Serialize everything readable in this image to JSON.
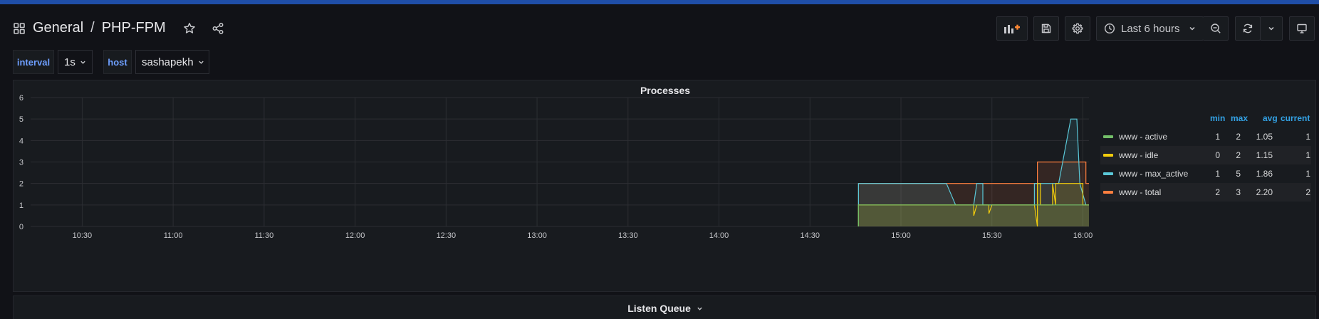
{
  "breadcrumb": {
    "folder": "General",
    "separator": "/",
    "dashboard": "PHP-FPM"
  },
  "toolbar": {
    "time_range": "Last 6 hours"
  },
  "variables": [
    {
      "label": "interval",
      "value": "1s"
    },
    {
      "label": "host",
      "value": "sashapekh"
    }
  ],
  "panel": {
    "title": "Processes",
    "legend": {
      "headers": {
        "min": "min",
        "max": "max",
        "avg": "avg",
        "current": "current"
      },
      "items": [
        {
          "name": "www - active",
          "color": "#73bf69",
          "min": "1",
          "max": "2",
          "avg": "1.05",
          "current": "1"
        },
        {
          "name": "www - idle",
          "color": "#f2cc0c",
          "min": "0",
          "max": "2",
          "avg": "1.15",
          "current": "1"
        },
        {
          "name": "www - max_active",
          "color": "#5ac8d8",
          "min": "1",
          "max": "5",
          "avg": "1.86",
          "current": "1"
        },
        {
          "name": "www - total",
          "color": "#ff7f3f",
          "min": "2",
          "max": "3",
          "avg": "2.20",
          "current": "2"
        }
      ]
    }
  },
  "chart_data": {
    "type": "area",
    "title": "Processes",
    "x_ticks": [
      "10:30",
      "11:00",
      "11:30",
      "12:00",
      "12:30",
      "13:00",
      "13:30",
      "14:00",
      "14:30",
      "15:00",
      "15:30",
      "16:00"
    ],
    "y_ticks": [
      "0",
      "1",
      "2",
      "3",
      "4",
      "5",
      "6"
    ],
    "ylim": [
      0,
      6
    ],
    "xlim": [
      "10:13",
      "16:02"
    ],
    "grid": true,
    "legend_position": "right",
    "series": [
      {
        "name": "www - total",
        "color": "#ff7f3f",
        "x": [
          "14:46",
          "14:46",
          "15:22",
          "15:22",
          "15:45",
          "15:45",
          "16:01",
          "16:01",
          "16:02"
        ],
        "y": [
          0,
          2,
          2,
          2,
          2,
          3,
          3,
          2,
          2
        ]
      },
      {
        "name": "www - max_active",
        "color": "#5ac8d8",
        "x": [
          "14:46",
          "14:46",
          "15:15",
          "15:18",
          "15:24",
          "15:25",
          "15:25",
          "15:27",
          "15:27",
          "15:35",
          "15:44",
          "15:44",
          "15:52",
          "15:56",
          "15:58",
          "15:59",
          "16:01",
          "16:02"
        ],
        "y": [
          0,
          2,
          2,
          1,
          1,
          2,
          2,
          2,
          1,
          1,
          1,
          2,
          2,
          5,
          5,
          2,
          1,
          1
        ]
      },
      {
        "name": "www - idle",
        "color": "#f2cc0c",
        "x": [
          "14:46",
          "14:46",
          "15:24",
          "15:24",
          "15:25",
          "15:29",
          "15:29",
          "15:30",
          "15:44",
          "15:45",
          "15:45",
          "15:46",
          "15:46",
          "15:50",
          "15:50",
          "15:51",
          "15:51",
          "16:00",
          "16:00",
          "16:02"
        ],
        "y": [
          0,
          1,
          1,
          0.5,
          1,
          1,
          0.6,
          1,
          1,
          0,
          2,
          2,
          1,
          1,
          2,
          1,
          2,
          2,
          1,
          1
        ]
      },
      {
        "name": "www - active",
        "color": "#73bf69",
        "x": [
          "14:46",
          "14:46",
          "15:45",
          "15:45",
          "16:02"
        ],
        "y": [
          0,
          1,
          1,
          1,
          1
        ]
      }
    ]
  },
  "section": {
    "title": "Listen Queue"
  }
}
